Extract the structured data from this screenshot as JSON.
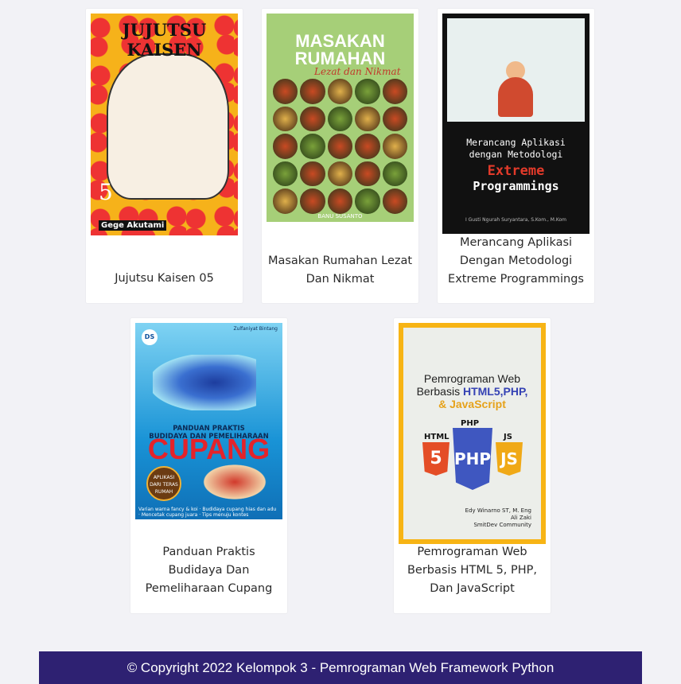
{
  "books": [
    {
      "title": "Jujutsu Kaisen 05",
      "cover": {
        "logo": "JUJUTSU KAISEN",
        "volume": "5",
        "author": "Gege Akutami",
        "colors": [
          "#f6b21a",
          "#e33333"
        ]
      }
    },
    {
      "title": "Masakan Rumahan Lezat Dan Nikmat",
      "cover": {
        "line1": "MASAKAN",
        "line2": "RUMAHAN",
        "line3": "Lezat dan Nikmat",
        "author": "BANU SUSANTO",
        "colors": [
          "#a6cf78"
        ]
      }
    },
    {
      "title": "Merancang Aplikasi Dengan Metodologi Extreme Programmings",
      "cover": {
        "line1": "Merancang Aplikasi",
        "line2": "dengan Metodologi",
        "line3": "Extreme",
        "line4": "Programmings",
        "author": "I Gusti Ngurah Suryantara, S.Kom., M.Kom",
        "colors": [
          "#111111",
          "#e23a2a"
        ]
      }
    },
    {
      "title": "Panduan Praktis Budidaya Dan Pemeliharaan Cupang",
      "cover": {
        "line1": "PANDUAN PRAKTIS",
        "line2": "BUDIDAYA DAN PEMELIHARAAN",
        "line3": "CUPANG",
        "badge": "APLIKASI DARI TERAS RUMAH",
        "publisher": "Zulfaniyat Bintang",
        "footer": "Varian warna fancy & koi · Budidaya cupang hias dan adu · Mencetak cupang juara · Tips menuju kontes",
        "colors": [
          "#1993d6",
          "#e4232a"
        ]
      }
    },
    {
      "title": "Pemrograman Web Berbasis HTML 5, PHP, Dan JavaScript",
      "cover": {
        "line1": "Pemrograman Web",
        "line2": "Berbasis",
        "line2b": "HTML5,PHP,",
        "line3": "& JavaScript",
        "html5": "5",
        "php": "PHP",
        "js": "JS",
        "label_html": "HTML",
        "label_php": "PHP",
        "label_js": "JS",
        "authors": [
          "Edy Winarno ST, M. Eng",
          "Ali Zaki",
          "SmitDev Community"
        ],
        "colors": [
          "#f7b415",
          "#3f57c0",
          "#e44d26"
        ]
      }
    }
  ],
  "footer": {
    "text": "© Copyright 2022 Kelompok 3 - Pemrograman Web Framework Python",
    "color": "#2e2172"
  }
}
